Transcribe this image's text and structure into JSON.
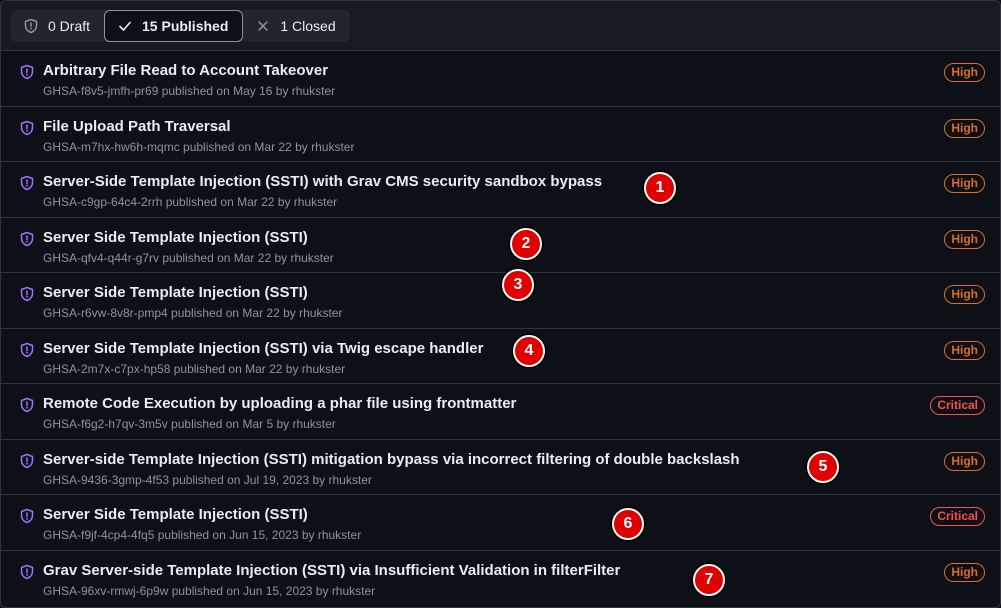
{
  "colors": {
    "background": "#0d1117",
    "border": "#30363d",
    "title": "#e6edf3",
    "muted": "#8b949e",
    "shield": "#a371f7",
    "high": "#db6d28",
    "critical": "#f85149",
    "marker": "#e00000"
  },
  "tabs": [
    {
      "label": "0 Draft",
      "icon": "shield-icon",
      "active": false
    },
    {
      "label": "15 Published",
      "icon": "check-icon",
      "active": true
    },
    {
      "label": "1 Closed",
      "icon": "close-icon",
      "active": false
    }
  ],
  "advisories": [
    {
      "title": "Arbitrary File Read to Account Takeover",
      "meta": "GHSA-f8v5-jmfh-pr69 published on May 16 by rhukster",
      "severity": "High"
    },
    {
      "title": "File Upload Path Traversal",
      "meta": "GHSA-m7hx-hw6h-mqmc published on Mar 22 by rhukster",
      "severity": "High"
    },
    {
      "title": "Server-Side Template Injection (SSTI) with Grav CMS security sandbox bypass",
      "meta": "GHSA-c9gp-64c4-2rrh published on Mar 22 by rhukster",
      "severity": "High"
    },
    {
      "title": "Server Side Template Injection (SSTI)",
      "meta": "GHSA-qfv4-q44r-g7rv published on Mar 22 by rhukster",
      "severity": "High"
    },
    {
      "title": "Server Side Template Injection (SSTI)",
      "meta": "GHSA-r6vw-8v8r-pmp4 published on Mar 22 by rhukster",
      "severity": "High"
    },
    {
      "title": "Server Side Template Injection (SSTI) via Twig escape handler",
      "meta": "GHSA-2m7x-c7px-hp58 published on Mar 22 by rhukster",
      "severity": "High"
    },
    {
      "title": "Remote Code Execution by uploading a phar file using frontmatter",
      "meta": "GHSA-f6g2-h7qv-3m5v published on Mar 5 by rhukster",
      "severity": "Critical"
    },
    {
      "title": "Server-side Template Injection (SSTI) mitigation bypass via incorrect filtering of double backslash",
      "meta": "GHSA-9436-3gmp-4f53 published on Jul 19, 2023 by rhukster",
      "severity": "High"
    },
    {
      "title": "Server Side Template Injection (SSTI)",
      "meta": "GHSA-f9jf-4cp4-4fq5 published on Jun 15, 2023 by rhukster",
      "severity": "Critical"
    },
    {
      "title": "Grav Server-side Template Injection (SSTI) via Insufficient Validation in filterFilter",
      "meta": "GHSA-96xv-rmwj-6p9w published on Jun 15, 2023 by rhukster",
      "severity": "High"
    }
  ],
  "markers": [
    {
      "label": "1"
    },
    {
      "label": "2"
    },
    {
      "label": "3"
    },
    {
      "label": "4"
    },
    {
      "label": "5"
    },
    {
      "label": "6"
    },
    {
      "label": "7"
    }
  ]
}
